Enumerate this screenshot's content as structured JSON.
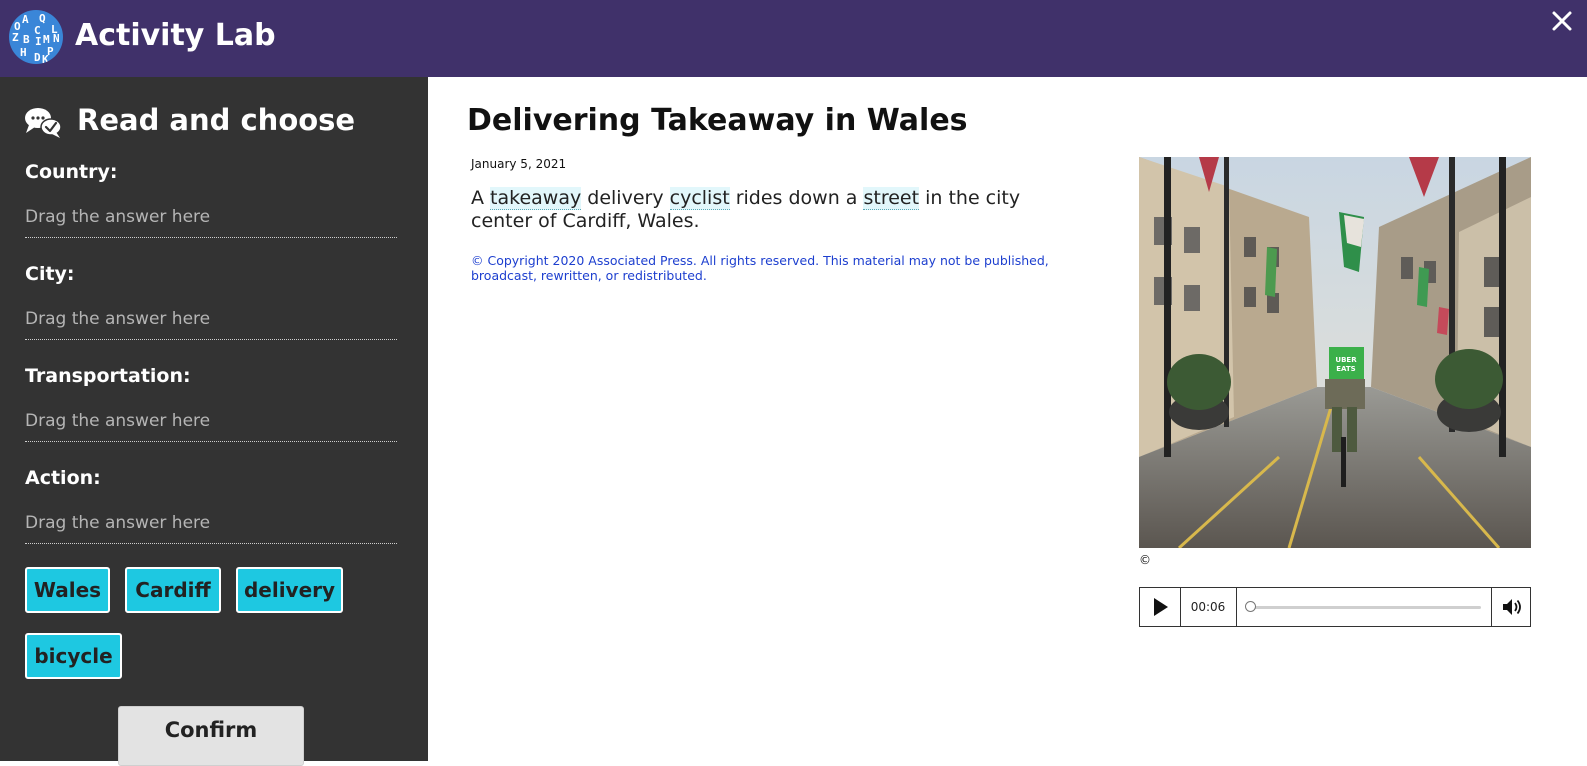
{
  "header": {
    "app_title": "Activity Lab",
    "logo_letters": [
      "A",
      "Q",
      "C",
      "Z",
      "B",
      "I",
      "M",
      "N",
      "H",
      "D",
      "P",
      "L",
      "O",
      "K"
    ],
    "close_icon": "close-icon"
  },
  "sidebar": {
    "heading": "Read and choose",
    "heading_icon": "chat-check-icon",
    "fields": [
      {
        "label": "Country:",
        "placeholder": "Drag the answer here"
      },
      {
        "label": "City:",
        "placeholder": "Drag the answer here"
      },
      {
        "label": "Transportation:",
        "placeholder": "Drag the answer here"
      },
      {
        "label": "Action:",
        "placeholder": "Drag the answer here"
      }
    ],
    "answers": [
      "Wales",
      "Cardiff",
      "delivery",
      "bicycle"
    ],
    "confirm_label": "Confirm"
  },
  "article": {
    "title": "Delivering Takeaway in Wales",
    "date": "January 5, 2021",
    "body": {
      "t0": "A ",
      "v1": "takeaway",
      "t1": " delivery ",
      "v2": "cyclist",
      "t2": " rides down a ",
      "v3": "street",
      "t3": " in the city center of Cardiff, Wales."
    },
    "copyright": "© Copyright 2020 Associated Press. All rights reserved. This material may not be published, broadcast, rewritten, or redistributed.",
    "photo_credit": "©",
    "photo_badge": {
      "line1": "UBER",
      "line2": "EATS"
    }
  },
  "player": {
    "time": "00:06",
    "progress": 0.0,
    "play_icon": "play-icon",
    "volume_icon": "volume-icon"
  },
  "colors": {
    "header_bg": "#40316a",
    "sidebar_bg": "#333333",
    "chip_bg": "#1ec8e1",
    "copyright_text": "#1d3fcf",
    "vocab_highlight": "#e2f7fb"
  }
}
